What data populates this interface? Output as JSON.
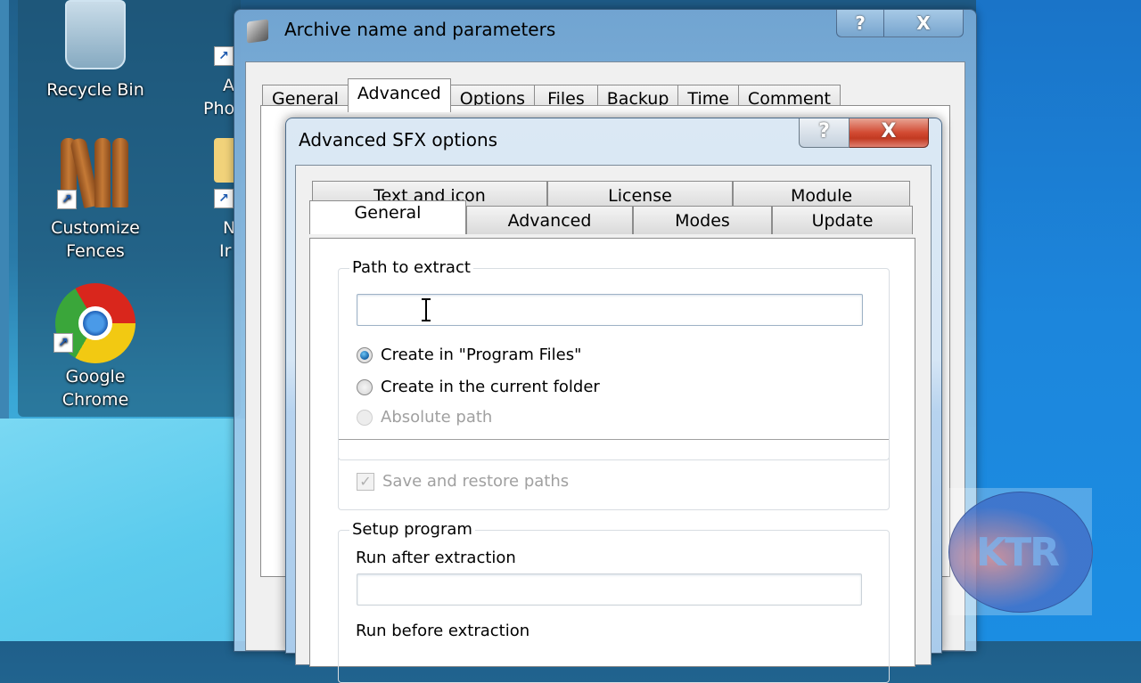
{
  "desktop": {
    "icons": [
      {
        "label": "Recycle Bin",
        "icon": "recycle-bin-icon"
      },
      {
        "label": "Customize Fences",
        "label_line1": "Customize",
        "label_line2": "Fences",
        "icon": "fences-icon"
      },
      {
        "label": "Google Chrome",
        "label_line1": "Google",
        "label_line2": "Chrome",
        "icon": "chrome-icon"
      }
    ],
    "partial_icons": [
      {
        "line1": "A",
        "line2": "Pho"
      },
      {
        "line1": "N",
        "line2": "Ir"
      }
    ],
    "watermark": "KTR"
  },
  "outer_window": {
    "title": "Archive name and parameters",
    "help_glyph": "?",
    "close_glyph": "X",
    "tabs": [
      {
        "label": "General",
        "active": false
      },
      {
        "label": "Advanced",
        "active": true
      },
      {
        "label": "Options",
        "active": false
      },
      {
        "label": "Files",
        "active": false
      },
      {
        "label": "Backup",
        "active": false
      },
      {
        "label": "Time",
        "active": false
      },
      {
        "label": "Comment",
        "active": false
      }
    ]
  },
  "inner_window": {
    "title": "Advanced SFX options",
    "help_glyph": "?",
    "close_glyph": "X",
    "tabs_row1": [
      {
        "label": "Text and icon"
      },
      {
        "label": "License"
      },
      {
        "label": "Module"
      }
    ],
    "tabs_row2": [
      {
        "label": "General",
        "active": true
      },
      {
        "label": "Advanced",
        "active": false
      },
      {
        "label": "Modes",
        "active": false
      },
      {
        "label": "Update",
        "active": false
      }
    ],
    "path_group": {
      "label": "Path to extract",
      "input_value": "",
      "radios": [
        {
          "label": "Create in \"Program Files\"",
          "checked": true,
          "disabled": false
        },
        {
          "label": "Create in the current folder",
          "checked": false,
          "disabled": false
        },
        {
          "label": "Absolute path",
          "checked": false,
          "disabled": true
        }
      ],
      "save_restore": {
        "label": "Save and restore paths",
        "checked": true,
        "disabled": true
      }
    },
    "setup_group": {
      "label": "Setup program",
      "run_after_label": "Run after extraction",
      "run_after_value": "",
      "run_before_label": "Run before extraction"
    }
  }
}
